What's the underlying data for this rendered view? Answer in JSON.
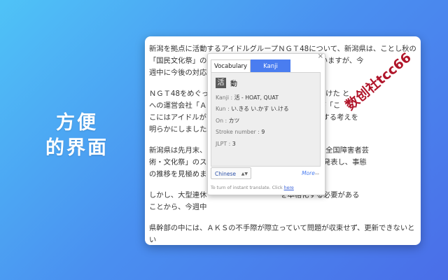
{
  "headline": {
    "line1": "方便",
    "line2": "的界面"
  },
  "article": {
    "paragraphs": [
      "新潟を拠点に活動するアイドルグループＮＧＴ48について、新潟県は、ことし秋の\n「国民文化祭」の                                  を保留していますが、今\n週中に今後の対応",
      "ＮＧＴ48をめぐっ                             ファンが押しかけた と\nへの運営会社「ＡＫ                              は山口さんが「こ\nこにはアイドルが                               べて来月    表する考えを\n明らかにしました。",
      "新潟県は先月末、Ｎ                                 化祭」と「全国障害者芸\n術・文化祭」のス                                を保留すると発表し、事態\nの推移を見極めま",
      "しかし、大型連休                                を本格化する必要がある\nことから、今週中",
      "県幹部の中には、ＡＫＳの不手際が際立っていて問題が収束せず、更新できないとい\nう見方が広がる一方、ＡＫＳの対応とは別にＮＧＴ48は新潟にとって貴重な存在だ\nという意見もあり花角知事が近く、判断することにしています。"
    ]
  },
  "popup": {
    "close": "×",
    "tabs": [
      "Vocabulary",
      "Kanji"
    ],
    "active_tab": "Kanji",
    "word": "活",
    "word_alt": "動",
    "details": [
      {
        "label": "Kanji :",
        "value": "活 - HOAT, QUAT"
      },
      {
        "label": "Kun :",
        "value": "い.きる い.かす い.ける"
      },
      {
        "label": "On :",
        "value": "カツ"
      },
      {
        "label": "Stroke number :",
        "value": "9"
      },
      {
        "label": "JLPT :",
        "value": "3"
      }
    ],
    "language": "Chinese",
    "more": "More",
    "more_chevron": "»»",
    "hint_prefix": "To turn of instant translate. Click ",
    "hint_link": "here"
  },
  "watermark": "数创社tcc66",
  "colors": {
    "accent": "#4a7df0",
    "watermark": "#b0152a"
  }
}
